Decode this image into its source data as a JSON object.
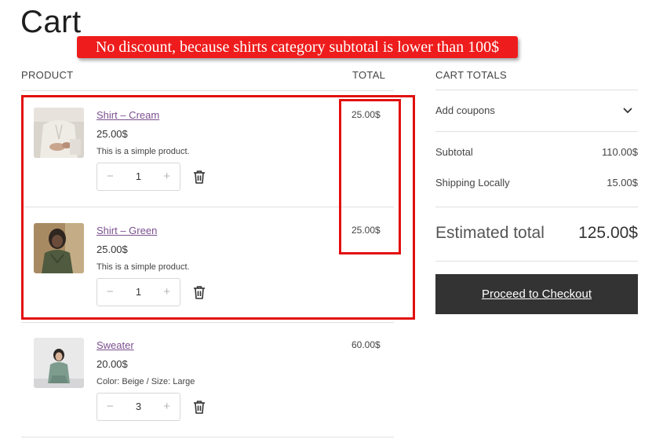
{
  "page": {
    "title": "Cart"
  },
  "annotation": {
    "text": "No discount, because shirts category subtotal is lower than 100$"
  },
  "table": {
    "product_header": "PRODUCT",
    "total_header": "TOTAL"
  },
  "items": [
    {
      "name": "Shirt – Cream",
      "price": "25.00$",
      "description": "This is a simple product.",
      "quantity": "1",
      "total": "25.00$"
    },
    {
      "name": "Shirt – Green",
      "price": "25.00$",
      "description": "This is a simple product.",
      "quantity": "1",
      "total": "25.00$"
    },
    {
      "name": "Sweater",
      "price": "20.00$",
      "description": "Color: Beige / Size: Large",
      "quantity": "3",
      "total": "60.00$"
    }
  ],
  "qty_controls": {
    "minus": "−",
    "plus": "+"
  },
  "cart_totals": {
    "heading": "CART TOTALS",
    "coupon_label": "Add coupons",
    "subtotal_label": "Subtotal",
    "subtotal_value": "110.00$",
    "shipping_label": "Shipping Locally",
    "shipping_value": "15.00$",
    "estimated_label": "Estimated total",
    "estimated_value": "125.00$",
    "checkout_label": "Proceed to Checkout"
  },
  "colors": {
    "highlight": "#e30f0f",
    "link": "#7b4f8f",
    "checkout_bg": "#333333"
  }
}
